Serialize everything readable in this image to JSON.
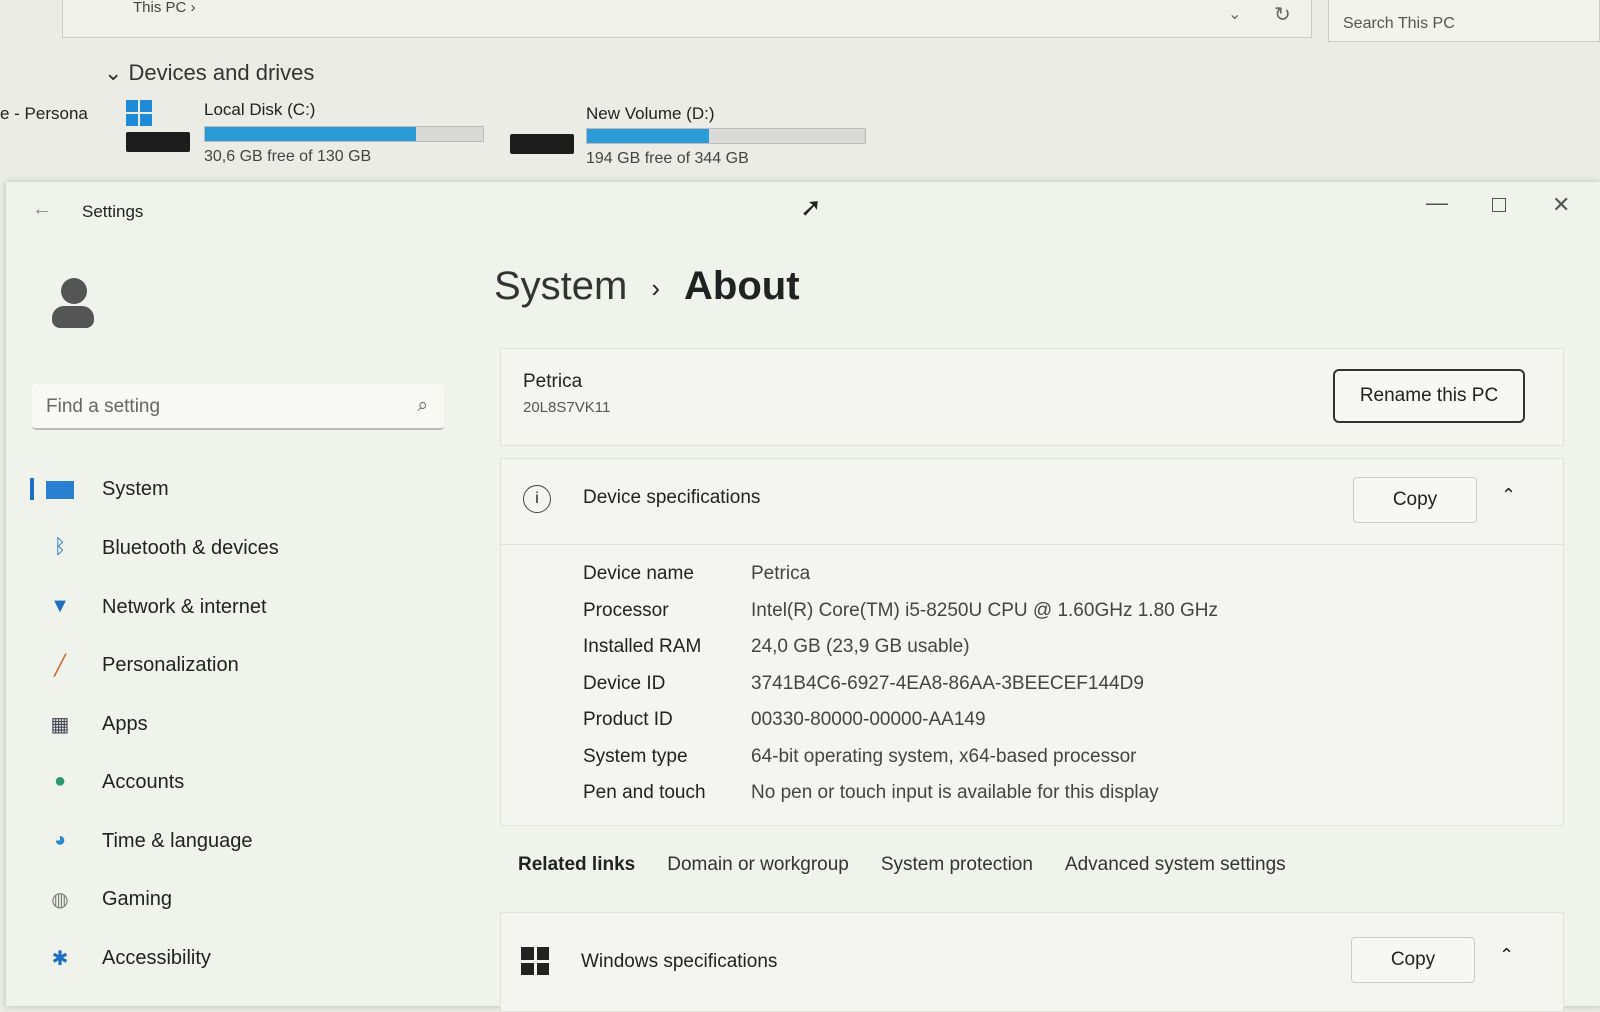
{
  "explorer": {
    "breadcrumb": "This PC",
    "search_placeholder": "Search This PC",
    "section": "Devices and drives",
    "side_item": "e - Persona",
    "drives": [
      {
        "name": "Local Disk (C:)",
        "free": "30,6 GB free of 130 GB",
        "used_fraction": 0.76
      },
      {
        "name": "New Volume (D:)",
        "free": "194 GB free of 344 GB",
        "used_fraction": 0.44
      }
    ],
    "accent": "#2a9bd6"
  },
  "settings": {
    "title": "Settings",
    "search_placeholder": "Find a setting",
    "nav": [
      {
        "label": "System",
        "icon": "monitor-icon"
      },
      {
        "label": "Bluetooth & devices",
        "icon": "bluetooth-icon"
      },
      {
        "label": "Network & internet",
        "icon": "wifi-icon"
      },
      {
        "label": "Personalization",
        "icon": "brush-icon"
      },
      {
        "label": "Apps",
        "icon": "apps-icon"
      },
      {
        "label": "Accounts",
        "icon": "person-icon"
      },
      {
        "label": "Time & language",
        "icon": "globe-clock-icon"
      },
      {
        "label": "Gaming",
        "icon": "gamepad-icon"
      },
      {
        "label": "Accessibility",
        "icon": "accessibility-icon"
      }
    ],
    "breadcrumb": {
      "parent": "System",
      "current": "About"
    },
    "pc": {
      "name": "Petrica",
      "model": "20L8S7VK11",
      "rename": "Rename this PC"
    },
    "device_specs": {
      "title": "Device specifications",
      "copy": "Copy",
      "rows": [
        {
          "k": "Device name",
          "v": "Petrica"
        },
        {
          "k": "Processor",
          "v": "Intel(R) Core(TM) i5-8250U CPU @ 1.60GHz   1.80 GHz"
        },
        {
          "k": "Installed RAM",
          "v": "24,0 GB (23,9 GB usable)"
        },
        {
          "k": "Device ID",
          "v": "3741B4C6-6927-4EA8-86AA-3BEECEF144D9"
        },
        {
          "k": "Product ID",
          "v": "00330-80000-00000-AA149"
        },
        {
          "k": "System type",
          "v": "64-bit operating system, x64-based processor"
        },
        {
          "k": "Pen and touch",
          "v": "No pen or touch input is available for this display"
        }
      ]
    },
    "related": {
      "label": "Related links",
      "links": [
        "Domain or workgroup",
        "System protection",
        "Advanced system settings"
      ]
    },
    "windows_specs": {
      "title": "Windows specifications",
      "copy": "Copy"
    }
  }
}
